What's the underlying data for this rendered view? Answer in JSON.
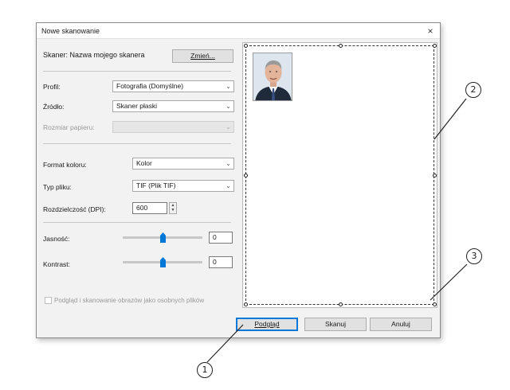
{
  "window": {
    "title": "Nowe skanowanie",
    "close_icon": "×"
  },
  "scanner": {
    "label": "Skaner: Nazwa mojego skanera",
    "change_button": "Zmień..."
  },
  "profile": {
    "label": "Profil:",
    "value": "Fotografia (Domyślne)"
  },
  "source": {
    "label": "Źródło:",
    "value": "Skaner płaski"
  },
  "paper_size": {
    "label": "Rozmiar papieru:",
    "value": ""
  },
  "color_format": {
    "label": "Format koloru:",
    "value": "Kolor"
  },
  "file_type": {
    "label": "Typ pliku:",
    "value": "TIF (Plik TIF)"
  },
  "resolution": {
    "label": "Rozdzielczość (DPI):",
    "value": "600"
  },
  "brightness": {
    "label": "Jasność:",
    "value": "0",
    "level": 0.5
  },
  "contrast": {
    "label": "Kontrast:",
    "value": "0",
    "level": 0.5
  },
  "separate_files": {
    "label": "Podgląd i skanowanie obrazów jako osobnych plików",
    "checked": false
  },
  "buttons": {
    "preview": "Podgląd",
    "scan": "Skanuj",
    "cancel": "Anuluj"
  },
  "callouts": {
    "one": "1",
    "two": "2",
    "three": "3"
  },
  "colors": {
    "accent": "#0078d7",
    "dialog_bg": "#f2f2f2"
  }
}
